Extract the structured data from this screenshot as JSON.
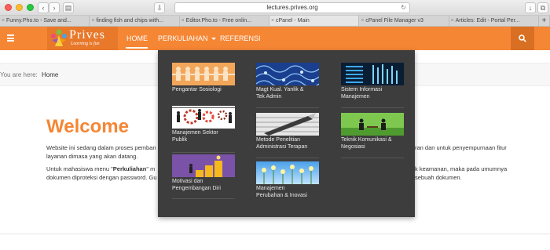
{
  "browser": {
    "url": "lectures.prives.org",
    "tabs": [
      {
        "title": "Funny.Pho.to - Save and..."
      },
      {
        "title": "finding fish and chips with..."
      },
      {
        "title": "Editor.Pho.to - Free onlin..."
      },
      {
        "title": "cPanel - Main"
      },
      {
        "title": "cPanel File Manager v3"
      },
      {
        "title": "Articles: Edit - Portal Per..."
      }
    ],
    "active_tab_index": 3
  },
  "site": {
    "logo_name": "Prives",
    "logo_tagline": "Learning is fun",
    "nav": [
      {
        "label": "HOME"
      },
      {
        "label": "PERKULIAHAN"
      },
      {
        "label": "REFERENSI"
      }
    ],
    "colors": {
      "accent": "#f58634",
      "dropdown_bg": "#3d3d3d"
    }
  },
  "breadcrumb": {
    "label": "You are here:",
    "current": "Home"
  },
  "content": {
    "title": "Welcome",
    "para1_line1": "Website ini sedang dalam proses pemban",
    "para1_line1_end": "ran dan untuk penyempurnaan fitur",
    "para1_line2": "layanan dimasa yang akan datang.",
    "para2_line1_prefix": "Untuk mahasiswa menu \"",
    "para2_line1_bold": "Perkuliahan",
    "para2_line1_suffix": "\" m",
    "para2_line1_end": "k keamanan, maka pada umumnya",
    "para2_line2": "dokumen diproteksi dengan password. Gu",
    "para2_line2_end": "sebuah dokumen."
  },
  "dropdown": {
    "items": [
      {
        "label_1": "Pengantar Sosiologi",
        "label_2": "",
        "thumb": "people-chain"
      },
      {
        "label_1": "Magt Kual. Yanlik &",
        "label_2": "Tek Admin",
        "thumb": "blue-pattern"
      },
      {
        "label_1": "Sistem Informasi",
        "label_2": "Manajemen",
        "thumb": "server-rack"
      },
      {
        "label_1": "Manajemen Sektor",
        "label_2": "Publik",
        "thumb": "gears-people"
      },
      {
        "label_1": "Metode Penelitian",
        "label_2": "Administrasi Terapan",
        "thumb": "pen-sketch"
      },
      {
        "label_1": "Teknik Komunikasi &",
        "label_2": "Negosiasi",
        "thumb": "business-meeting"
      },
      {
        "label_1": "Motivasi dan",
        "label_2": "Pengembangan Diri",
        "thumb": "stairs-goal"
      },
      {
        "label_1": "Manajemen",
        "label_2": "Perubahan & Inovasi",
        "thumb": "flowers-sky"
      }
    ]
  }
}
